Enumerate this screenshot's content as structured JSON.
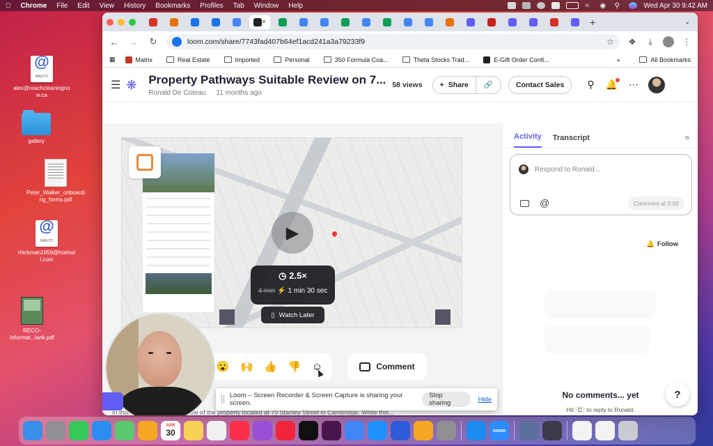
{
  "menubar": {
    "apple": "",
    "items": [
      "Chrome",
      "File",
      "Edit",
      "View",
      "History",
      "Bookmarks",
      "Profiles",
      "Tab",
      "Window",
      "Help"
    ],
    "clock": "Wed Apr 30  9:42 AM"
  },
  "desktop": {
    "icons": [
      {
        "label": "alex@reachcleaningnow.ca",
        "badge": "MAILTO"
      },
      {
        "label": "gallery"
      },
      {
        "label": "Peter_Walker_onboarding_forms.pdf"
      },
      {
        "label": "rhickman1959@hotmail.com",
        "badge": "MAILTO"
      },
      {
        "label": "RECO-Informat...lank.pdf"
      }
    ]
  },
  "browser": {
    "tab_colors": [
      "#d93025",
      "#e8710a",
      "#1a73e8",
      "#1a73e8",
      "#4285f4",
      "#222222",
      "#0f9d58",
      "#4285f4",
      "#4285f4",
      "#0f9d58",
      "#4285f4",
      "#0f9d58",
      "#4285f4",
      "#4285f4",
      "#e8710a",
      "#625df5",
      "#c5221f",
      "#625df5",
      "#625df5",
      "#d93025",
      "#625df5"
    ],
    "url": "loom.com/share/7743fad407b64ef1acd241a3a79233f9",
    "bookmarks": [
      {
        "label": "Matrix",
        "type": "site"
      },
      {
        "label": "Real Estate",
        "type": "folder"
      },
      {
        "label": "Imported",
        "type": "folder"
      },
      {
        "label": "Personal",
        "type": "folder"
      },
      {
        "label": "350 Formula Coa...",
        "type": "folder"
      },
      {
        "label": "Theta Stocks Trad...",
        "type": "folder"
      },
      {
        "label": "E-Gift Order Confi...",
        "type": "site"
      }
    ],
    "more": "»",
    "all_bookmarks": "All Bookmarks"
  },
  "loom": {
    "title": "Property Pathways Suitable Review on 7...",
    "author": "Ronald De Coteau",
    "age": "11 months ago",
    "views": "58 views",
    "share_label": "Share",
    "contact_label": "Contact Sales",
    "video": {
      "speed": "2.5×",
      "old_time": "4 min",
      "new_time": "1 min 30 sec",
      "watch_later": "Watch Later"
    },
    "comment_label": "Comment",
    "intro_text": "In this video, I provide a review of the property located at 70 Stanley Street in Cambridge. While this...",
    "activity_tab": "Activity",
    "transcript_tab": "Transcript",
    "respond_placeholder": "Respond to Ronald...",
    "comment_at": "Comment at 0:00",
    "follow_label": "Follow",
    "no_comments": "No comments... yet",
    "hint_pre": "Hit",
    "hint_key": "C",
    "hint_post": "to reply to Ronald.",
    "help": "?"
  },
  "sharebar": {
    "message": "Loom – Screen Recorder & Screen Capture is sharing your screen.",
    "stop": "Stop sharing",
    "hide": "Hide"
  },
  "dock": {
    "calendar_month": "APR",
    "calendar_day": "30",
    "zoom_label": "zoom",
    "apps": [
      {
        "name": "finder",
        "color": "#3b8ee8"
      },
      {
        "name": "launchpad",
        "color": "#8e8e93"
      },
      {
        "name": "messages",
        "color": "#34c759"
      },
      {
        "name": "mail",
        "color": "#2d8cf0"
      },
      {
        "name": "maps",
        "color": "#5ac86c"
      },
      {
        "name": "photos",
        "color": "#f5a623"
      },
      {
        "name": "calendar",
        "color": "#ffffff"
      },
      {
        "name": "notes",
        "color": "#f7d154"
      },
      {
        "name": "reminders",
        "color": "#f0f0f0"
      },
      {
        "name": "music",
        "color": "#fa2d48"
      },
      {
        "name": "podcasts",
        "color": "#9b4fd6"
      },
      {
        "name": "news",
        "color": "#f0243a"
      },
      {
        "name": "tv",
        "color": "#111111"
      },
      {
        "name": "slack",
        "color": "#4a154b"
      },
      {
        "name": "chrome",
        "color": "#4285f4"
      },
      {
        "name": "safari",
        "color": "#1e90ff"
      },
      {
        "name": "spark",
        "color": "#2f5bd8"
      },
      {
        "name": "pages",
        "color": "#f5a623"
      },
      {
        "name": "settings",
        "color": "#8e8e93"
      },
      {
        "name": "appstore",
        "color": "#1c8cf0"
      },
      {
        "name": "zoom",
        "color": "#2d8cff"
      },
      {
        "name": "preview",
        "color": "#5b6f9a"
      },
      {
        "name": "quicktime",
        "color": "#3a3a4a"
      }
    ]
  }
}
